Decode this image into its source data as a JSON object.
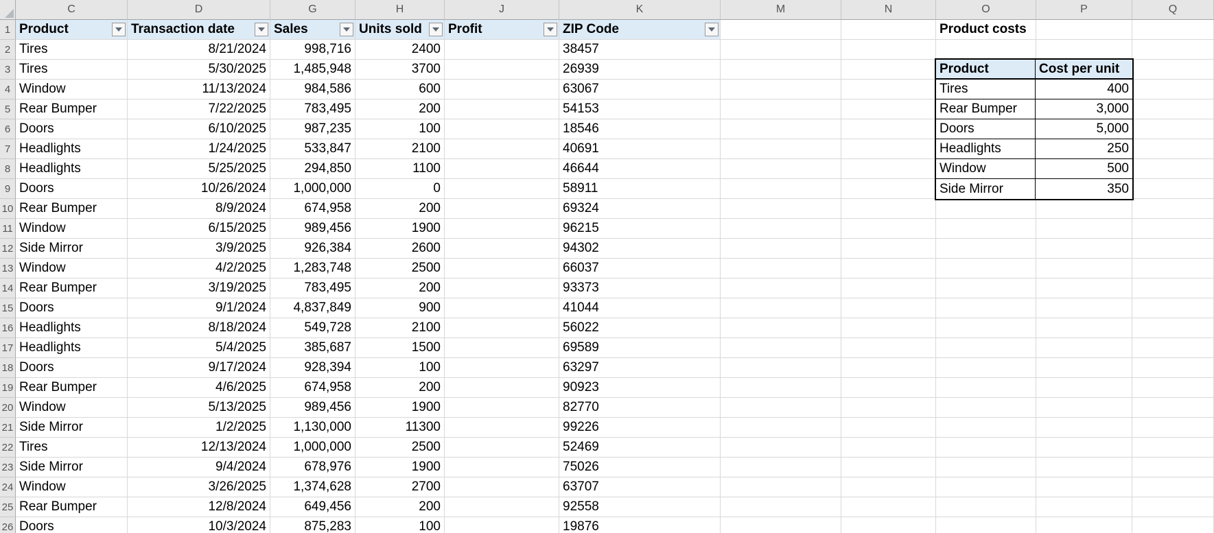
{
  "sheet": {
    "column_letters": [
      "C",
      "D",
      "G",
      "H",
      "J",
      "K",
      "M",
      "N",
      "O",
      "P",
      "Q"
    ],
    "row_numbers": [
      1,
      2,
      3,
      4,
      5,
      6,
      7,
      8,
      9,
      10,
      11,
      12,
      13,
      14,
      15,
      16,
      17,
      18,
      19,
      20,
      21,
      22,
      23,
      24,
      25,
      26
    ]
  },
  "colors": {
    "header_fill": "#DDEBF7",
    "gridline": "#D8D8D8",
    "header_strip": "#E6E6E6",
    "table_border": "#000000"
  },
  "table": {
    "headers": [
      {
        "col": "C",
        "label": "Product",
        "filter": true
      },
      {
        "col": "D",
        "label": "Transaction date",
        "filter": true
      },
      {
        "col": "G",
        "label": "Sales",
        "filter": true
      },
      {
        "col": "H",
        "label": "Units sold",
        "filter": true
      },
      {
        "col": "J",
        "label": "Profit",
        "filter": true
      },
      {
        "col": "K",
        "label": "ZIP Code",
        "filter": true
      }
    ],
    "records": [
      {
        "product": "Tires",
        "date": "8/21/2024",
        "sales": "998,716",
        "units": "2400",
        "profit": "",
        "zip": "38457"
      },
      {
        "product": "Tires",
        "date": "5/30/2025",
        "sales": "1,485,948",
        "units": "3700",
        "profit": "",
        "zip": "26939"
      },
      {
        "product": "Window",
        "date": "11/13/2024",
        "sales": "984,586",
        "units": "600",
        "profit": "",
        "zip": "63067"
      },
      {
        "product": "Rear Bumper",
        "date": "7/22/2025",
        "sales": "783,495",
        "units": "200",
        "profit": "",
        "zip": "54153"
      },
      {
        "product": "Doors",
        "date": "6/10/2025",
        "sales": "987,235",
        "units": "100",
        "profit": "",
        "zip": "18546"
      },
      {
        "product": "Headlights",
        "date": "1/24/2025",
        "sales": "533,847",
        "units": "2100",
        "profit": "",
        "zip": "40691"
      },
      {
        "product": "Headlights",
        "date": "5/25/2025",
        "sales": "294,850",
        "units": "1100",
        "profit": "",
        "zip": "46644"
      },
      {
        "product": "Doors",
        "date": "10/26/2024",
        "sales": "1,000,000",
        "units": "0",
        "profit": "",
        "zip": "58911"
      },
      {
        "product": "Rear Bumper",
        "date": "8/9/2024",
        "sales": "674,958",
        "units": "200",
        "profit": "",
        "zip": "69324"
      },
      {
        "product": "Window",
        "date": "6/15/2025",
        "sales": "989,456",
        "units": "1900",
        "profit": "",
        "zip": "96215"
      },
      {
        "product": "Side Mirror",
        "date": "3/9/2025",
        "sales": "926,384",
        "units": "2600",
        "profit": "",
        "zip": "94302"
      },
      {
        "product": "Window",
        "date": "4/2/2025",
        "sales": "1,283,748",
        "units": "2500",
        "profit": "",
        "zip": "66037"
      },
      {
        "product": "Rear Bumper",
        "date": "3/19/2025",
        "sales": "783,495",
        "units": "200",
        "profit": "",
        "zip": "93373"
      },
      {
        "product": "Doors",
        "date": "9/1/2024",
        "sales": "4,837,849",
        "units": "900",
        "profit": "",
        "zip": "41044"
      },
      {
        "product": "Headlights",
        "date": "8/18/2024",
        "sales": "549,728",
        "units": "2100",
        "profit": "",
        "zip": "56022"
      },
      {
        "product": "Headlights",
        "date": "5/4/2025",
        "sales": "385,687",
        "units": "1500",
        "profit": "",
        "zip": "69589"
      },
      {
        "product": "Doors",
        "date": "9/17/2024",
        "sales": "928,394",
        "units": "100",
        "profit": "",
        "zip": "63297"
      },
      {
        "product": "Rear Bumper",
        "date": "4/6/2025",
        "sales": "674,958",
        "units": "200",
        "profit": "",
        "zip": "90923"
      },
      {
        "product": "Window",
        "date": "5/13/2025",
        "sales": "989,456",
        "units": "1900",
        "profit": "",
        "zip": "82770"
      },
      {
        "product": "Side Mirror",
        "date": "1/2/2025",
        "sales": "1,130,000",
        "units": "11300",
        "profit": "",
        "zip": "99226"
      },
      {
        "product": "Tires",
        "date": "12/13/2024",
        "sales": "1,000,000",
        "units": "2500",
        "profit": "",
        "zip": "52469"
      },
      {
        "product": "Side Mirror",
        "date": "9/4/2024",
        "sales": "678,976",
        "units": "1900",
        "profit": "",
        "zip": "75026"
      },
      {
        "product": "Window",
        "date": "3/26/2025",
        "sales": "1,374,628",
        "units": "2700",
        "profit": "",
        "zip": "63707"
      },
      {
        "product": "Rear Bumper",
        "date": "12/8/2024",
        "sales": "649,456",
        "units": "200",
        "profit": "",
        "zip": "92558"
      },
      {
        "product": "Doors",
        "date": "10/3/2024",
        "sales": "875,283",
        "units": "100",
        "profit": "",
        "zip": "19876"
      }
    ]
  },
  "costs": {
    "title": "Product costs",
    "headers": [
      "Product",
      "Cost per unit"
    ],
    "rows": [
      {
        "product": "Tires",
        "cost": "400"
      },
      {
        "product": "Rear Bumper",
        "cost": "3,000"
      },
      {
        "product": "Doors",
        "cost": "5,000"
      },
      {
        "product": "Headlights",
        "cost": "250"
      },
      {
        "product": "Window",
        "cost": "500"
      },
      {
        "product": "Side Mirror",
        "cost": "350"
      }
    ]
  }
}
